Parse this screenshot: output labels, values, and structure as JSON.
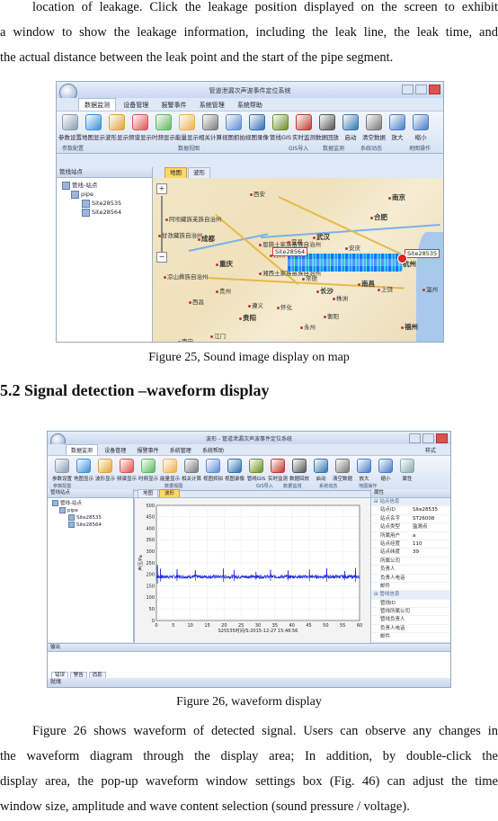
{
  "doc": {
    "para_top_lines": [
      "location of leakage. Click the leakage position displayed on the screen to exhibit",
      "a window to show the leakage information, including the leak line, the leak time, and",
      "the actual distance between the leak point and the start of the pipe segment."
    ],
    "figure25_caption": "Figure 25, Sound image display on map",
    "section_heading": "5.2 Signal detection –waveform display",
    "figure26_caption": "Figure 26, waveform display",
    "para_bottom_lines": [
      "Figure 26 shows waveform of detected signal. Users can observe any changes in",
      "the waveform diagram through the display area; In addition, by double-click the",
      "display area, the pop-up waveform window settings box (Fig. 46) can adjust the time",
      "window size, amplitude and wave content selection (sound pressure / voltage)."
    ]
  },
  "app1": {
    "window_title": "管道泄漏次声波事件定位系统",
    "menu": [
      "数据监测",
      "设备管理",
      "报警事件",
      "系统管理",
      "系统帮助"
    ],
    "ribbon_buttons": [
      "参数设置",
      "地图显示",
      "波形显示",
      "频谱显示",
      "时频显示",
      "能量显示",
      "相关计算",
      "视图抓拍",
      "视图录像",
      "管线GIS",
      "实时监测",
      "数据回放",
      "启动",
      "清空数据",
      "放大",
      "缩小"
    ],
    "ribbon_groups": [
      "参数配置",
      "数据视图",
      "GIS导入",
      "数据监测",
      "系统动态",
      "地图操作"
    ],
    "panel_title": "管线站点",
    "tree": [
      "管线-站点",
      "pipe",
      "Site28535",
      "Site28564"
    ],
    "tabs": [
      "地图",
      "波形"
    ],
    "map_cities": [
      "合肥",
      "武汉",
      "长沙",
      "重庆",
      "成都",
      "贵阳",
      "南京",
      "杭州",
      "南昌",
      "福州",
      "西安",
      "安庆",
      "恩施土家族苗族自治州",
      "湘西土家族苗族自治州",
      "阿坝藏族羌族自治州",
      "甘孜藏族自治州",
      "凉山彝族自治州",
      "南宁",
      "江门",
      "万州",
      "宜昌",
      "岳阳",
      "常德",
      "株洲",
      "衡阳",
      "永州",
      "贵州",
      "遵义",
      "九江",
      "上饶",
      "温州",
      "怀化",
      "西昌"
    ],
    "site_left": "Site28564",
    "site_right": "Site28535"
  },
  "app2": {
    "window_title": "波形 - 管道泄漏次声波事件定位系统",
    "style_label": "样式",
    "menu": [
      "数据监测",
      "设备管理",
      "报警事件",
      "系统管理",
      "系统帮助"
    ],
    "ribbon_buttons": [
      "参数设置",
      "地图显示",
      "波形显示",
      "频谱显示",
      "时频显示",
      "能量显示",
      "相关计算",
      "视图抓拍",
      "视图录像",
      "管线GIS",
      "实时监测",
      "数据回放",
      "启动",
      "清空数据",
      "放大",
      "缩小",
      "属性"
    ],
    "ribbon_groups": [
      "参数配置",
      "数据视图",
      "GIS导入",
      "数据监测",
      "系统动态",
      "地图操作"
    ],
    "panel_title": "管线站点",
    "tree": [
      "管线-站点",
      "pipe",
      "Site28535",
      "Site28564"
    ],
    "tabs": [
      "地图",
      "波形"
    ],
    "props_title": "属性",
    "props_section1": "站点信息",
    "props": [
      {
        "k": "站点ID",
        "v": "Site28535"
      },
      {
        "k": "站点名字",
        "v": "ST26008"
      },
      {
        "k": "站点类型",
        "v": "监测点"
      },
      {
        "k": "所属用户",
        "v": "a"
      },
      {
        "k": "站点经度",
        "v": "110"
      },
      {
        "k": "站点纬度",
        "v": "39"
      },
      {
        "k": "所属公司",
        "v": ""
      },
      {
        "k": "负责人",
        "v": ""
      },
      {
        "k": "负责人电话",
        "v": ""
      },
      {
        "k": "邮件",
        "v": ""
      }
    ],
    "props_section2": "管线信息",
    "props2": [
      {
        "k": "管线ID",
        "v": ""
      },
      {
        "k": "管线所属公司",
        "v": ""
      },
      {
        "k": "管线负责人",
        "v": ""
      },
      {
        "k": "负责人电话",
        "v": ""
      },
      {
        "k": "邮件",
        "v": ""
      }
    ],
    "output_title": "输出",
    "output_tabs": [
      "错误",
      "警告",
      "消息"
    ],
    "status": "就绪"
  },
  "chart_data": {
    "type": "line",
    "title": "",
    "ylabel": "声压/Pa",
    "xlabel": "S25535时间/S:2015-12-27 15:48:56",
    "xlim": [
      0,
      60
    ],
    "ylim": [
      0,
      500
    ],
    "xticks": [
      0,
      5,
      10,
      15,
      20,
      25,
      30,
      35,
      40,
      45,
      50,
      55,
      60
    ],
    "yticks": [
      0,
      50,
      100,
      150,
      200,
      250,
      300,
      350,
      400,
      450,
      500
    ],
    "grid": true,
    "series": [
      {
        "color": "#1f2bd8",
        "baseline": 190,
        "noise": 8,
        "spikes": [
          [
            0.3,
            240
          ],
          [
            1.2,
            225
          ],
          [
            6.1,
            222
          ],
          [
            11.5,
            218
          ],
          [
            19.8,
            226
          ],
          [
            23.0,
            220
          ],
          [
            29.4,
            212
          ],
          [
            33.7,
            220
          ],
          [
            38.9,
            217
          ],
          [
            45.2,
            222
          ],
          [
            50.3,
            226
          ],
          [
            55.6,
            215
          ],
          [
            58.8,
            228
          ]
        ]
      }
    ]
  }
}
